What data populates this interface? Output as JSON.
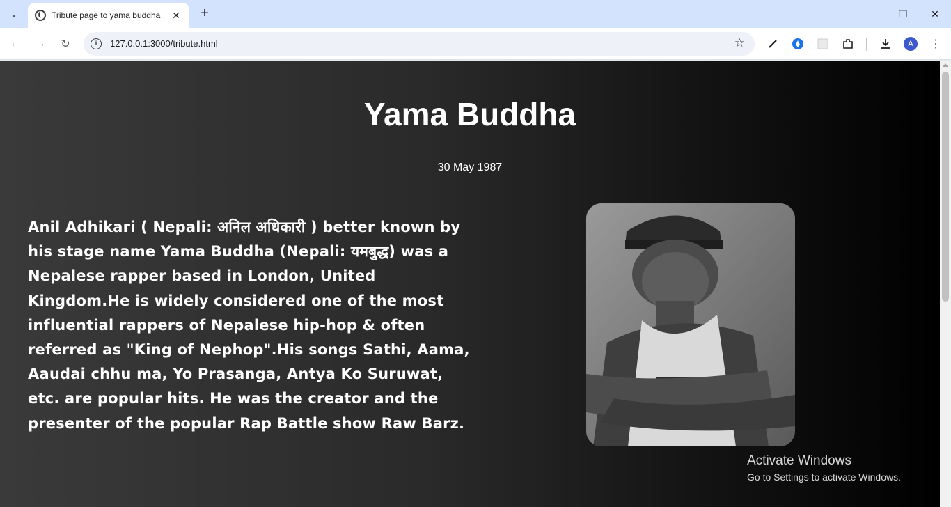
{
  "browser": {
    "tab_title": "Tribute page to yama buddha",
    "url": "127.0.0.1:3000/tribute.html",
    "avatar_letter": "A"
  },
  "page": {
    "heading": "Yama Buddha",
    "date": "30 May 1987",
    "bio": "Anil Adhikari ( Nepali: अनिल अधिकारी ) better known by his stage name Yama Buddha (Nepali: यमबुद्ध) was a Nepalese rapper based in London, United Kingdom.He is widely considered one of the most influential rappers of Nepalese hip-hop & often referred as \"King of Nephop\".His songs Sathi, Aama, Aaudai chhu ma, Yo Prasanga, Antya Ko Suruwat, etc. are popular hits. He was the creator and the presenter of the popular Rap Battle show Raw Barz."
  },
  "watermark": {
    "title": "Activate Windows",
    "subtitle": "Go to Settings to activate Windows."
  },
  "colors": {
    "tabstrip": "#d3e3fd",
    "page_bg_left": "#3a3a3a",
    "page_bg_right": "#000000",
    "avatar": "#3b5bcc"
  }
}
